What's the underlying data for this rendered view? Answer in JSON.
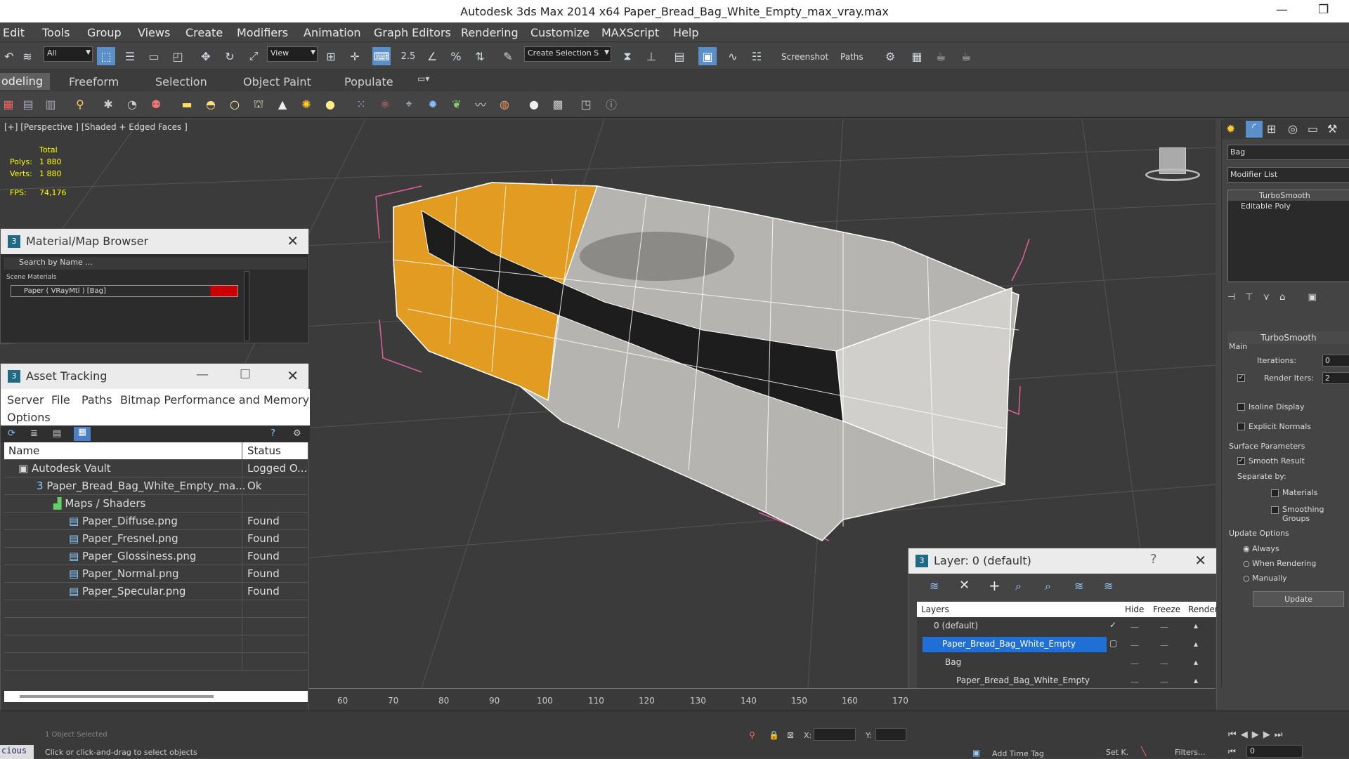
{
  "window": {
    "title": "Autodesk 3ds Max  2014 x64      Paper_Bread_Bag_White_Empty_max_vray.max",
    "minimize": "—",
    "maximize": "❐"
  },
  "menu": [
    "Edit",
    "Tools",
    "Group",
    "Views",
    "Create",
    "Modifiers",
    "Animation",
    "Graph Editors",
    "Rendering",
    "Customize",
    "MAXScript",
    "Help"
  ],
  "toolbar": {
    "filter": "All",
    "ref_coord": "View",
    "selection_set": "Create Selection S",
    "screenshot": "Screenshot",
    "paths": "Paths",
    "snap_label": "2.5"
  },
  "ribbon_tabs": [
    "odeling",
    "Freeform",
    "Selection",
    "Object Paint",
    "Populate"
  ],
  "viewport": {
    "label": "[+] [Perspective ] [Shaded + Edged Faces ]",
    "stats": {
      "total": "Total",
      "polys_label": "Polys:",
      "polys": "1 880",
      "verts_label": "Verts:",
      "verts": "1 880",
      "fps_label": "FPS:",
      "fps": "74,176"
    }
  },
  "material_browser": {
    "title": "Material/Map Browser",
    "search": "Search by Name ...",
    "section": "Scene Materials",
    "item": "Paper ( VRayMtl ) [Bag]"
  },
  "asset_tracking": {
    "title": "Asset Tracking",
    "menu": [
      "Server",
      "File",
      "Paths",
      "Bitmap Performance and Memory"
    ],
    "menu2": "Options",
    "col_name": "Name",
    "col_status": "Status",
    "rows": [
      {
        "name": "Autodesk Vault",
        "status": "Logged O..."
      },
      {
        "name": "Paper_Bread_Bag_White_Empty_ma...",
        "status": "Ok"
      },
      {
        "name": "Maps / Shaders",
        "status": ""
      },
      {
        "name": "Paper_Diffuse.png",
        "status": "Found"
      },
      {
        "name": "Paper_Fresnel.png",
        "status": "Found"
      },
      {
        "name": "Paper_Glossiness.png",
        "status": "Found"
      },
      {
        "name": "Paper_Normal.png",
        "status": "Found"
      },
      {
        "name": "Paper_Specular.png",
        "status": "Found"
      }
    ]
  },
  "layer_dialog": {
    "title": "Layer: 0 (default)",
    "help": "?",
    "cols": {
      "layers": "Layers",
      "hide": "Hide",
      "freeze": "Freeze",
      "render": "Render"
    },
    "rows": [
      "0 (default)",
      "Paper_Bread_Bag_White_Empty",
      "Bag",
      "Paper_Bread_Bag_White_Empty"
    ]
  },
  "command_panel": {
    "object_name": "Bag",
    "modifier_list": "Modifier List",
    "stack": [
      "TurboSmooth",
      "Editable Poly"
    ],
    "rollout": "TurboSmooth",
    "main": "Main",
    "iterations_label": "Iterations:",
    "iterations": "0",
    "render_iters_label": "Render Iters:",
    "render_iters": "2",
    "isoline": "Isoline Display",
    "explicit": "Explicit Normals",
    "surface": "Surface Parameters",
    "smooth": "Smooth Result",
    "separate": "Separate by:",
    "materials": "Materials",
    "smoothing": "Smoothing Groups",
    "update_options": "Update Options",
    "always": "Always",
    "when_rendering": "When Rendering",
    "manually": "Manually",
    "update": "Update"
  },
  "timeline": [
    "60",
    "70",
    "80",
    "90",
    "100",
    "110",
    "120",
    "130",
    "140",
    "150",
    "160",
    "170"
  ],
  "status": {
    "selected": "1 Object Selected",
    "prompt": "Click or click-and-drag to select objects",
    "script": "cious",
    "x_label": "X:",
    "y_label": "Y:",
    "add_time_tag": "Add Time Tag",
    "set_key": "Set K.",
    "filters": "Filters...",
    "frame": "0"
  }
}
